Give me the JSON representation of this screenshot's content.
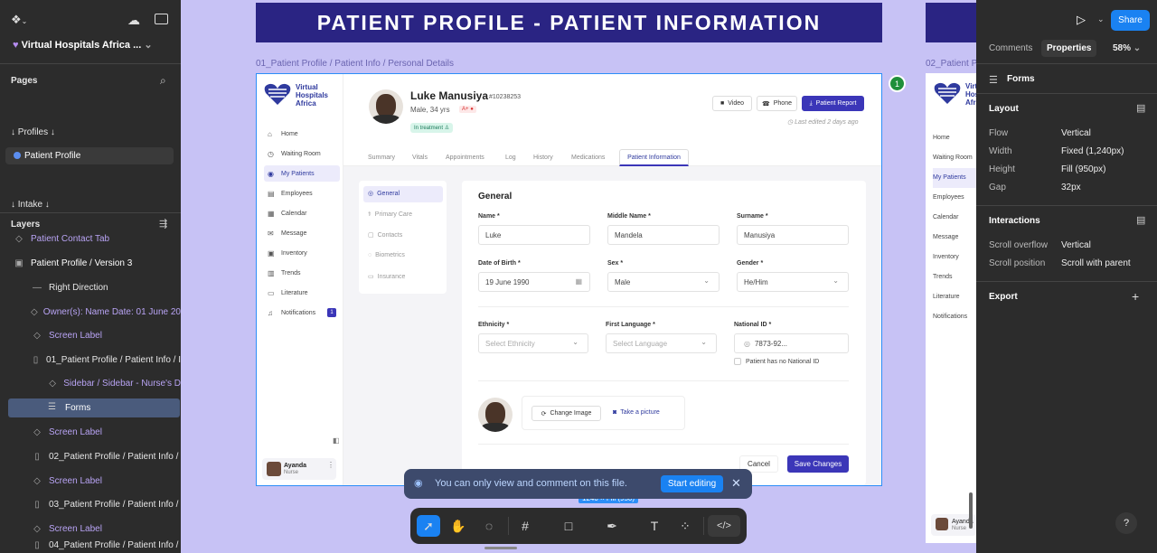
{
  "file": {
    "name": "Virtual Hospitals Africa ..."
  },
  "pages": {
    "header": "Pages",
    "items": [
      "↓ Profiles ↓",
      "Patient Profile",
      "↓ Intake ↓"
    ]
  },
  "layers": {
    "header": "Layers",
    "items": [
      "Patient Contact Tab",
      "Patient Profile / Version 3",
      "Right Direction",
      "Owner(s): Name Date: 01 June 20",
      "Screen Label",
      "01_Patient Profile / Patient Info / I",
      "Sidebar / Sidebar - Nurse's D",
      "Forms",
      "Screen Label",
      "02_Patient Profile / Patient Info /",
      "Screen Label",
      "03_Patient Profile / Patient Info /",
      "Screen Label",
      "04_Patient Profile / Patient Info /"
    ]
  },
  "canvas": {
    "banner": "PATIENT PROFILE - PATIENT INFORMATION",
    "frame1_label": "01_Patient Profile / Patient Info / Personal Details",
    "frame2_label": "02_Patient Profil",
    "size_badge": "1240 × Fill (950)",
    "comment_count": "1"
  },
  "app": {
    "brand": [
      "Virtual",
      "Hospitals",
      "Africa"
    ],
    "nav": [
      "Home",
      "Waiting Room",
      "My Patients",
      "Employees",
      "Calendar",
      "Message",
      "Inventory",
      "Trends",
      "Literature",
      "Notifications"
    ],
    "notif_count": "1",
    "user_name": "Ayanda",
    "user_role": "Nurse",
    "patient": {
      "name": "Luke Manusiya",
      "id": "#10238253",
      "meta": "Male, 34 yrs",
      "blood": "A+",
      "status": "In treatment",
      "last_edited": "Last edited 2 days ago"
    },
    "actions": {
      "video": "Video",
      "phone": "Phone",
      "report": "Patient Report"
    },
    "tabs": [
      "Summary",
      "Vitals",
      "Appointments",
      "Log",
      "History",
      "Medications",
      "Patient Information"
    ],
    "subnav": [
      "General",
      "Primary Care",
      "Contacts",
      "Biometrics",
      "Insurance"
    ],
    "form": {
      "title": "General",
      "name_label": "Name *",
      "name": "Luke",
      "middle_label": "Middle Name *",
      "middle": "Mandela",
      "surname_label": "Surname *",
      "surname": "Manusiya",
      "dob_label": "Date of Birth *",
      "dob": "19 June 1990",
      "sex_label": "Sex *",
      "sex": "Male",
      "gender_label": "Gender *",
      "gender": "He/Him",
      "ethnicity_label": "Ethnicity *",
      "ethnicity": "Select Ethnicity",
      "language_label": "First Language *",
      "language": "Select Language",
      "nid_label": "National ID *",
      "nid": "7873-92...",
      "no_nid": "Patient has no National ID",
      "change_image": "Change Image",
      "take_picture": "Take a picture",
      "cancel": "Cancel",
      "save": "Save Changes"
    }
  },
  "props": {
    "tabs": [
      "Comments",
      "Properties"
    ],
    "zoom": "58%",
    "share": "Share",
    "selected": "Forms",
    "layout_header": "Layout",
    "rows": [
      {
        "k": "Flow",
        "v": "Vertical"
      },
      {
        "k": "Width",
        "v": "Fixed (1,240px)"
      },
      {
        "k": "Height",
        "v": "Fill (950px)"
      },
      {
        "k": "Gap",
        "v": "32px"
      }
    ],
    "interactions_header": "Interactions",
    "irows": [
      {
        "k": "Scroll overflow",
        "v": "Vertical"
      },
      {
        "k": "Scroll position",
        "v": "Scroll with parent"
      }
    ],
    "export": "Export",
    "help": "?"
  },
  "toast": {
    "message": "You can only view and comment on this file.",
    "action": "Start editing"
  }
}
